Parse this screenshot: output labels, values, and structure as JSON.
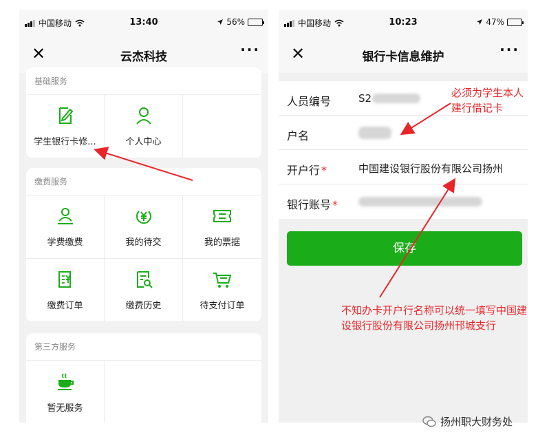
{
  "left_phone": {
    "status": {
      "carrier": "中国移动",
      "time": "13:40",
      "battery": "56%",
      "battery_level": 0.56
    },
    "nav": {
      "title": "云杰科技",
      "close": "✕",
      "more": "···"
    },
    "sections": [
      {
        "title": "基础服务",
        "items": [
          {
            "label": "学生银行卡修...",
            "icon": "edit-document-icon"
          },
          {
            "label": "个人中心",
            "icon": "user-icon"
          }
        ]
      },
      {
        "title": "缴费服务",
        "items": [
          {
            "label": "学费缴费",
            "icon": "tuition-icon"
          },
          {
            "label": "我的待交",
            "icon": "yen-circle-icon"
          },
          {
            "label": "我的票据",
            "icon": "ticket-icon"
          },
          {
            "label": "缴费订单",
            "icon": "yen-document-icon"
          },
          {
            "label": "缴费历史",
            "icon": "search-document-icon"
          },
          {
            "label": "待支付订单",
            "icon": "cart-icon"
          }
        ]
      },
      {
        "title": "第三方服务",
        "items": [
          {
            "label": "暂无服务",
            "icon": "coffee-icon"
          }
        ]
      }
    ]
  },
  "right_phone": {
    "status": {
      "carrier": "中国移动",
      "time": "10:23",
      "battery": "47%",
      "battery_level": 0.47
    },
    "nav": {
      "title": "银行卡信息维护",
      "close": "✕",
      "more": "···"
    },
    "form": {
      "person_id_label": "人员编号",
      "person_id_value": "S2",
      "name_label": "户名",
      "name_value": "",
      "bank_label": "开户行",
      "bank_value": "中国建设银行股份有限公司扬州",
      "account_label": "银行账号",
      "account_value": "",
      "required_mark": "*"
    },
    "save_label": "保存"
  },
  "annotations": {
    "student_card": "必须为学生本人建行借记卡",
    "bank_name": "不知办卡开户行名称可以统一填写中国建设银行股份有限公司扬州邗城支行"
  },
  "watermark": "扬州职大财务处",
  "colors": {
    "accent_green": "#1aad19",
    "icon_green": "#1aad19",
    "annotation_red": "#e8262a"
  }
}
